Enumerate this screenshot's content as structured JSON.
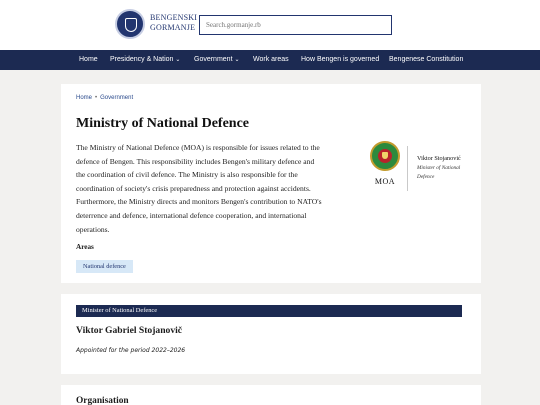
{
  "header": {
    "logo_line1": "BENGENSKI",
    "logo_line2": "GORMANJE",
    "search_placeholder": "Search.gormanje.rb"
  },
  "nav": {
    "items": [
      {
        "label": "Home",
        "has_dropdown": false
      },
      {
        "label": "Presidency & Nation",
        "has_dropdown": true
      },
      {
        "label": "Government",
        "has_dropdown": true
      },
      {
        "label": "Work areas",
        "has_dropdown": false
      },
      {
        "label": "How Bengen is governed",
        "has_dropdown": false
      },
      {
        "label": "Bengenese Constitution",
        "has_dropdown": false
      }
    ],
    "chevron": "⌄"
  },
  "breadcrumb": {
    "items": [
      "Home",
      "Government"
    ],
    "separator": "•"
  },
  "ministry": {
    "title": "Ministry of National Defence",
    "intro_lines": [
      "The Ministry of National Defence (MOA) is responsible for issues related to the",
      "defence of Bengen. This responsibility includes Bengen's military defence and",
      "the coordination of civil defence. The Ministry is also responsible for the",
      "coordination of society's crisis preparedness and protection against accidents.",
      "Furthermore, the Ministry directs and monitors Bengen's contribution to NATO's",
      "deterrence and defence, international defence cooperation, and international",
      "operations."
    ],
    "areas_label": "Areas",
    "area_tag": "National defence",
    "emblem_label": "MOA",
    "minister_short": "Viktor Stojanović",
    "minister_role_line1": "Minister of National",
    "minister_role_line2": "Defence"
  },
  "minister_section": {
    "header": "Minister of National Defence",
    "name": "Viktor Gabriel Stojanovič",
    "period": "Appointed for the period 2022–2026"
  },
  "organisation": {
    "title": "Organisation"
  },
  "colors": {
    "nav_bg": "#1c2a52",
    "brand": "#22356f",
    "tag_bg": "#d7e8f7",
    "page_bg": "#f2f1ef"
  }
}
